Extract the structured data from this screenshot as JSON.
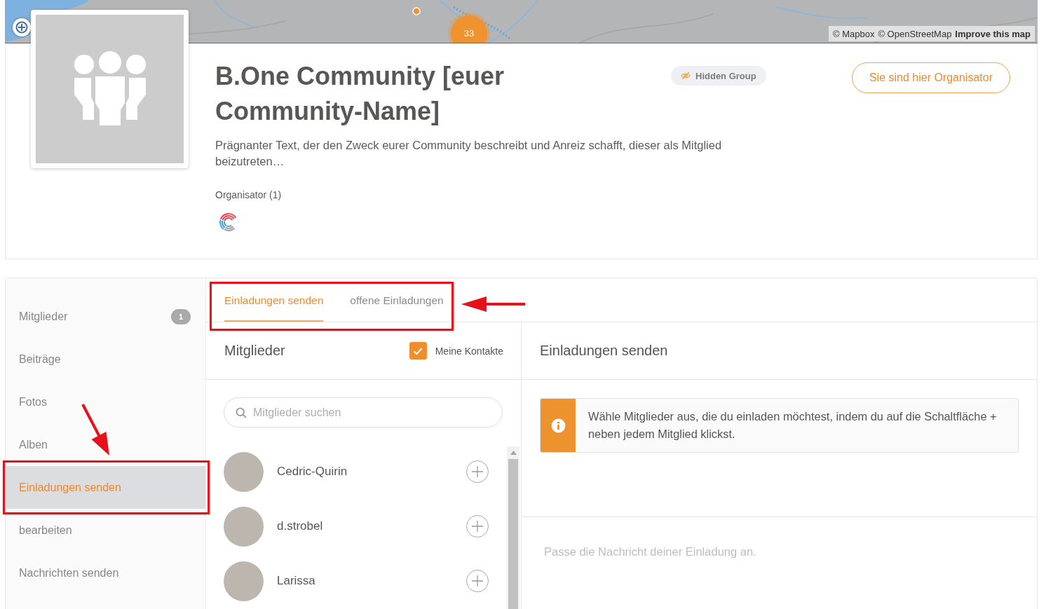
{
  "map": {
    "cluster_count": "33",
    "attribution": {
      "credits": [
        "© Mapbox",
        "© OpenStreetMap"
      ],
      "link": "Improve this map"
    }
  },
  "group": {
    "title": "B.One Community [euer Community-Name]",
    "badge": "Hidden Group",
    "role_button": "Sie sind hier Organisator",
    "description": "Prägnanter Text, der den Zweck eurer Community beschreibt und Anreiz schafft, dieser als Mitglied beizutreten…",
    "organizers_label": "Organisator (1)"
  },
  "sidebar": {
    "items": [
      {
        "label": "Mitglieder",
        "badge": "1",
        "selected": false
      },
      {
        "label": "Beiträge",
        "selected": false
      },
      {
        "label": "Fotos",
        "selected": false
      },
      {
        "label": "Alben",
        "selected": false
      },
      {
        "label": "Einladungen senden",
        "selected": true
      },
      {
        "label": "bearbeiten",
        "selected": false
      },
      {
        "label": "Nachrichten senden",
        "selected": false
      }
    ]
  },
  "tabs": [
    {
      "label": "Einladungen senden",
      "selected": true
    },
    {
      "label": "offene Einladungen",
      "selected": false
    }
  ],
  "members_panel": {
    "title": "Mitglieder",
    "contacts_filter": {
      "label": "Meine Kontakte",
      "checked": true
    },
    "search": {
      "placeholder": "Mitglieder suchen"
    },
    "members": [
      {
        "name": "Cedric-Quirin"
      },
      {
        "name": "d.strobel"
      },
      {
        "name": "Larissa"
      }
    ]
  },
  "invite_panel": {
    "title": "Einladungen senden",
    "info": "Wähle Mitglieder aus, die du einladen möchtest, indem du auf die Schaltfläche + neben jedem Mitglied klickst.",
    "message": {
      "placeholder": "Passe die Nachricht deiner Einladung an."
    }
  }
}
